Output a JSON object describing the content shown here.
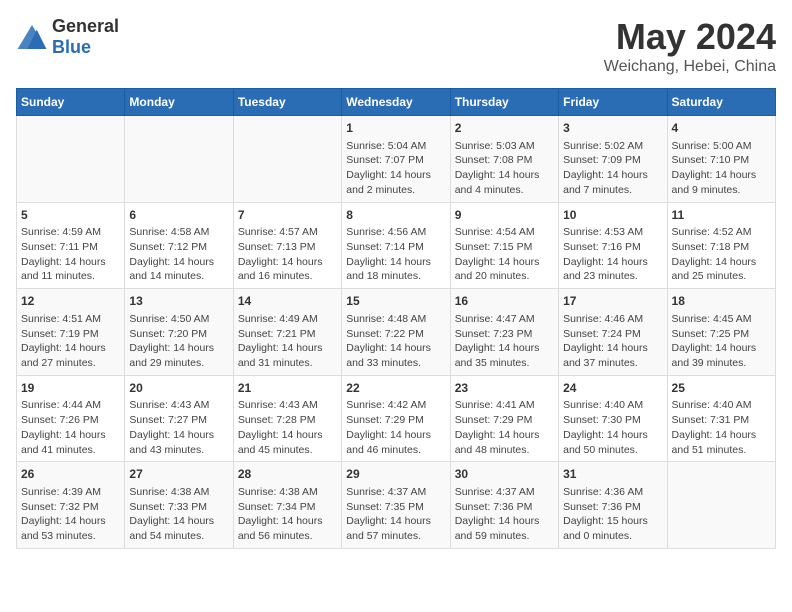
{
  "logo": {
    "text_general": "General",
    "text_blue": "Blue"
  },
  "header": {
    "title": "May 2024",
    "subtitle": "Weichang, Hebei, China"
  },
  "weekdays": [
    "Sunday",
    "Monday",
    "Tuesday",
    "Wednesday",
    "Thursday",
    "Friday",
    "Saturday"
  ],
  "weeks": [
    [
      {
        "day": "",
        "info": ""
      },
      {
        "day": "",
        "info": ""
      },
      {
        "day": "",
        "info": ""
      },
      {
        "day": "1",
        "info": "Sunrise: 5:04 AM\nSunset: 7:07 PM\nDaylight: 14 hours\nand 2 minutes."
      },
      {
        "day": "2",
        "info": "Sunrise: 5:03 AM\nSunset: 7:08 PM\nDaylight: 14 hours\nand 4 minutes."
      },
      {
        "day": "3",
        "info": "Sunrise: 5:02 AM\nSunset: 7:09 PM\nDaylight: 14 hours\nand 7 minutes."
      },
      {
        "day": "4",
        "info": "Sunrise: 5:00 AM\nSunset: 7:10 PM\nDaylight: 14 hours\nand 9 minutes."
      }
    ],
    [
      {
        "day": "5",
        "info": "Sunrise: 4:59 AM\nSunset: 7:11 PM\nDaylight: 14 hours\nand 11 minutes."
      },
      {
        "day": "6",
        "info": "Sunrise: 4:58 AM\nSunset: 7:12 PM\nDaylight: 14 hours\nand 14 minutes."
      },
      {
        "day": "7",
        "info": "Sunrise: 4:57 AM\nSunset: 7:13 PM\nDaylight: 14 hours\nand 16 minutes."
      },
      {
        "day": "8",
        "info": "Sunrise: 4:56 AM\nSunset: 7:14 PM\nDaylight: 14 hours\nand 18 minutes."
      },
      {
        "day": "9",
        "info": "Sunrise: 4:54 AM\nSunset: 7:15 PM\nDaylight: 14 hours\nand 20 minutes."
      },
      {
        "day": "10",
        "info": "Sunrise: 4:53 AM\nSunset: 7:16 PM\nDaylight: 14 hours\nand 23 minutes."
      },
      {
        "day": "11",
        "info": "Sunrise: 4:52 AM\nSunset: 7:18 PM\nDaylight: 14 hours\nand 25 minutes."
      }
    ],
    [
      {
        "day": "12",
        "info": "Sunrise: 4:51 AM\nSunset: 7:19 PM\nDaylight: 14 hours\nand 27 minutes."
      },
      {
        "day": "13",
        "info": "Sunrise: 4:50 AM\nSunset: 7:20 PM\nDaylight: 14 hours\nand 29 minutes."
      },
      {
        "day": "14",
        "info": "Sunrise: 4:49 AM\nSunset: 7:21 PM\nDaylight: 14 hours\nand 31 minutes."
      },
      {
        "day": "15",
        "info": "Sunrise: 4:48 AM\nSunset: 7:22 PM\nDaylight: 14 hours\nand 33 minutes."
      },
      {
        "day": "16",
        "info": "Sunrise: 4:47 AM\nSunset: 7:23 PM\nDaylight: 14 hours\nand 35 minutes."
      },
      {
        "day": "17",
        "info": "Sunrise: 4:46 AM\nSunset: 7:24 PM\nDaylight: 14 hours\nand 37 minutes."
      },
      {
        "day": "18",
        "info": "Sunrise: 4:45 AM\nSunset: 7:25 PM\nDaylight: 14 hours\nand 39 minutes."
      }
    ],
    [
      {
        "day": "19",
        "info": "Sunrise: 4:44 AM\nSunset: 7:26 PM\nDaylight: 14 hours\nand 41 minutes."
      },
      {
        "day": "20",
        "info": "Sunrise: 4:43 AM\nSunset: 7:27 PM\nDaylight: 14 hours\nand 43 minutes."
      },
      {
        "day": "21",
        "info": "Sunrise: 4:43 AM\nSunset: 7:28 PM\nDaylight: 14 hours\nand 45 minutes."
      },
      {
        "day": "22",
        "info": "Sunrise: 4:42 AM\nSunset: 7:29 PM\nDaylight: 14 hours\nand 46 minutes."
      },
      {
        "day": "23",
        "info": "Sunrise: 4:41 AM\nSunset: 7:29 PM\nDaylight: 14 hours\nand 48 minutes."
      },
      {
        "day": "24",
        "info": "Sunrise: 4:40 AM\nSunset: 7:30 PM\nDaylight: 14 hours\nand 50 minutes."
      },
      {
        "day": "25",
        "info": "Sunrise: 4:40 AM\nSunset: 7:31 PM\nDaylight: 14 hours\nand 51 minutes."
      }
    ],
    [
      {
        "day": "26",
        "info": "Sunrise: 4:39 AM\nSunset: 7:32 PM\nDaylight: 14 hours\nand 53 minutes."
      },
      {
        "day": "27",
        "info": "Sunrise: 4:38 AM\nSunset: 7:33 PM\nDaylight: 14 hours\nand 54 minutes."
      },
      {
        "day": "28",
        "info": "Sunrise: 4:38 AM\nSunset: 7:34 PM\nDaylight: 14 hours\nand 56 minutes."
      },
      {
        "day": "29",
        "info": "Sunrise: 4:37 AM\nSunset: 7:35 PM\nDaylight: 14 hours\nand 57 minutes."
      },
      {
        "day": "30",
        "info": "Sunrise: 4:37 AM\nSunset: 7:36 PM\nDaylight: 14 hours\nand 59 minutes."
      },
      {
        "day": "31",
        "info": "Sunrise: 4:36 AM\nSunset: 7:36 PM\nDaylight: 15 hours\nand 0 minutes."
      },
      {
        "day": "",
        "info": ""
      }
    ]
  ]
}
